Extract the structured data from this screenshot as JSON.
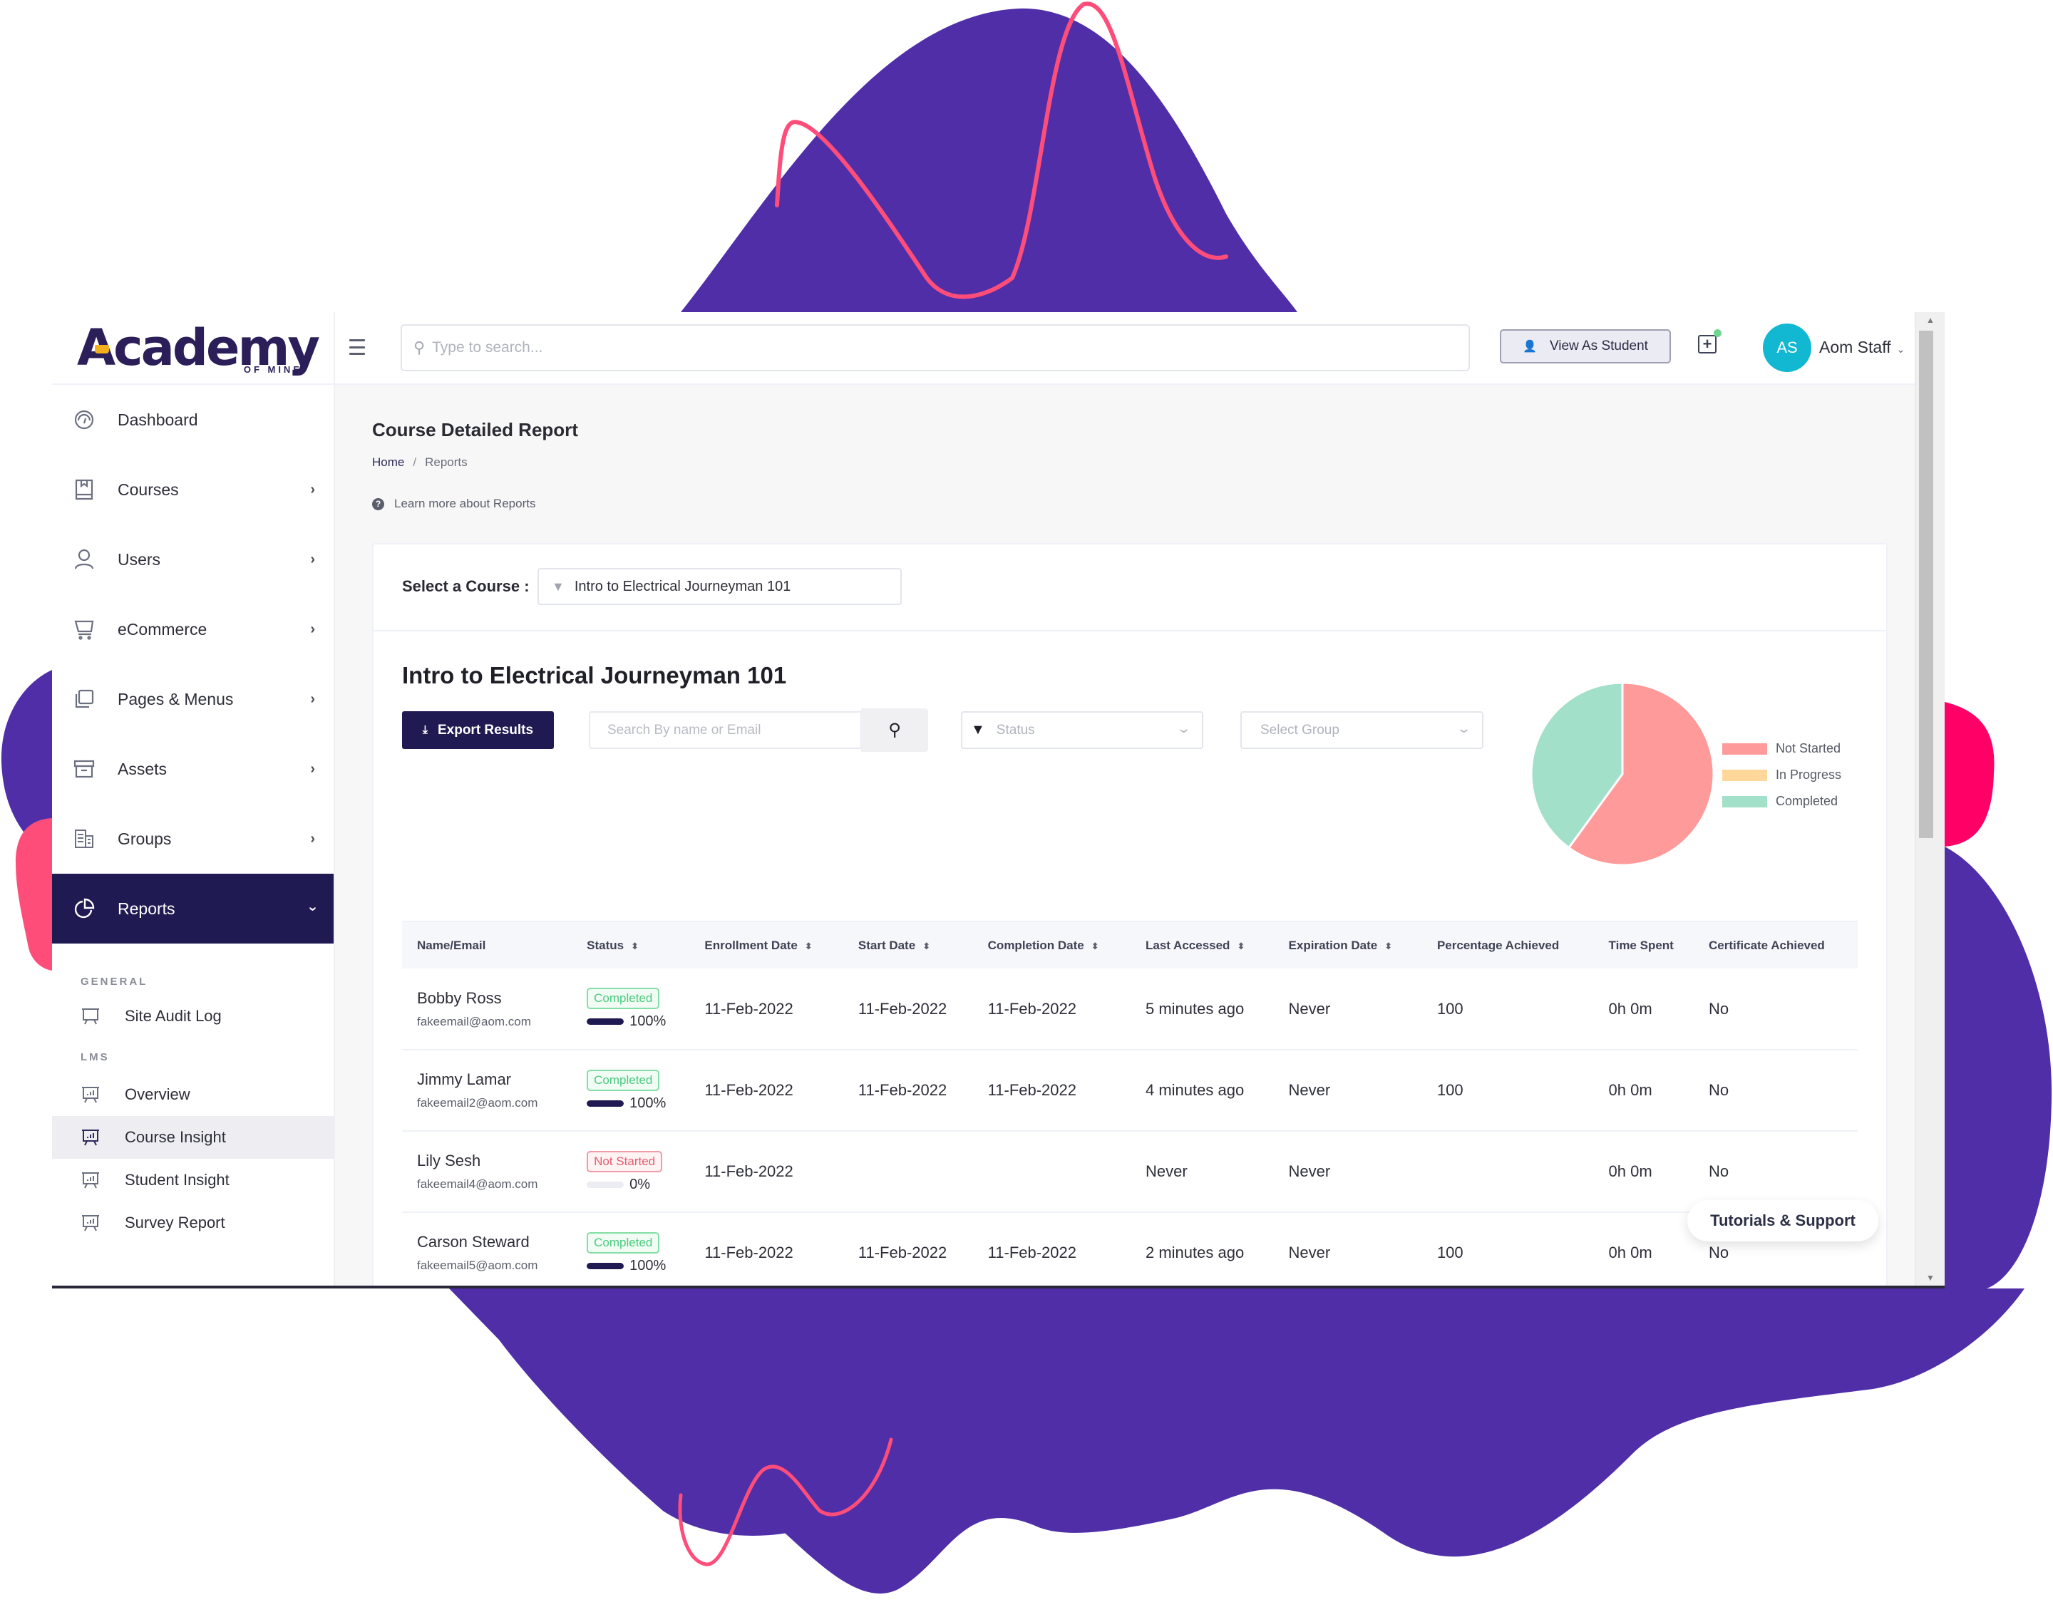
{
  "app": {
    "logo_text": "Academy",
    "logo_subtext": "OF MINE"
  },
  "header": {
    "search_placeholder": "Type to search...",
    "view_as_student": "View As Student",
    "avatar_initials": "AS",
    "user_name": "Aom Staff"
  },
  "sidebar": {
    "items": [
      {
        "label": "Dashboard",
        "icon": "gauge-icon",
        "has_children": false
      },
      {
        "label": "Courses",
        "icon": "book-icon",
        "has_children": true
      },
      {
        "label": "Users",
        "icon": "user-icon",
        "has_children": true
      },
      {
        "label": "eCommerce",
        "icon": "cart-icon",
        "has_children": true
      },
      {
        "label": "Pages & Menus",
        "icon": "pages-icon",
        "has_children": true
      },
      {
        "label": "Assets",
        "icon": "archive-icon",
        "has_children": true
      },
      {
        "label": "Groups",
        "icon": "building-icon",
        "has_children": true
      },
      {
        "label": "Reports",
        "icon": "pie-chart-icon",
        "has_children": true,
        "active": true
      }
    ],
    "reports_submenu": {
      "general_heading": "GENERAL",
      "general_items": [
        {
          "label": "Site Audit Log"
        }
      ],
      "lms_heading": "LMS",
      "lms_items": [
        {
          "label": "Overview"
        },
        {
          "label": "Course Insight",
          "current": true
        },
        {
          "label": "Student Insight"
        },
        {
          "label": "Survey Report"
        }
      ]
    }
  },
  "page": {
    "title": "Course Detailed Report",
    "breadcrumb": {
      "home": "Home",
      "separator": "/",
      "current": "Reports"
    },
    "learn_more": "Learn more about Reports",
    "select_course_label": "Select a Course :",
    "selected_course": "Intro to Electrical Journeyman 101",
    "course_heading": "Intro to Electrical Journeyman 101",
    "export_button": "Export Results",
    "name_search_placeholder": "Search By name or Email",
    "status_placeholder": "Status",
    "group_placeholder": "Select Group",
    "tutorials_button": "Tutorials & Support"
  },
  "chart_data": {
    "type": "pie",
    "title": "",
    "legend_position": "right",
    "categories": [
      "Not Started",
      "In Progress",
      "Completed"
    ],
    "values": [
      60,
      0,
      40
    ],
    "unit": "percent",
    "colors": [
      "#ff9a9a",
      "#ffd79a",
      "#a2e0c9"
    ]
  },
  "table": {
    "columns": [
      {
        "label": "Name/Email",
        "sortable": false
      },
      {
        "label": "Status",
        "sortable": true
      },
      {
        "label": "Enrollment Date",
        "sortable": true
      },
      {
        "label": "Start Date",
        "sortable": true
      },
      {
        "label": "Completion Date",
        "sortable": true
      },
      {
        "label": "Last Accessed",
        "sortable": true
      },
      {
        "label": "Expiration Date",
        "sortable": true
      },
      {
        "label": "Percentage Achieved",
        "sortable": false
      },
      {
        "label": "Time Spent",
        "sortable": false
      },
      {
        "label": "Certificate Achieved",
        "sortable": false
      }
    ],
    "rows": [
      {
        "name": "Bobby Ross",
        "email": "fakeemail@aom.com",
        "status": "Completed",
        "status_key": "completed",
        "progress": 100,
        "progress_label": "100%",
        "enrollment": "11-Feb-2022",
        "start": "11-Feb-2022",
        "completion": "11-Feb-2022",
        "last_accessed": "5 minutes ago",
        "expiration": "Never",
        "percentage": "100",
        "time_spent": "0h 0m",
        "certificate": "No"
      },
      {
        "name": "Jimmy Lamar",
        "email": "fakeemail2@aom.com",
        "status": "Completed",
        "status_key": "completed",
        "progress": 100,
        "progress_label": "100%",
        "enrollment": "11-Feb-2022",
        "start": "11-Feb-2022",
        "completion": "11-Feb-2022",
        "last_accessed": "4 minutes ago",
        "expiration": "Never",
        "percentage": "100",
        "time_spent": "0h 0m",
        "certificate": "No"
      },
      {
        "name": "Lily Sesh",
        "email": "fakeemail4@aom.com",
        "status": "Not Started",
        "status_key": "not-started",
        "progress": 0,
        "progress_label": "0%",
        "enrollment": "11-Feb-2022",
        "start": "",
        "completion": "",
        "last_accessed": "Never",
        "expiration": "Never",
        "percentage": "",
        "time_spent": "0h 0m",
        "certificate": "No"
      },
      {
        "name": "Carson Steward",
        "email": "fakeemail5@aom.com",
        "status": "Completed",
        "status_key": "completed",
        "progress": 100,
        "progress_label": "100%",
        "enrollment": "11-Feb-2022",
        "start": "11-Feb-2022",
        "completion": "11-Feb-2022",
        "last_accessed": "2 minutes ago",
        "expiration": "Never",
        "percentage": "100",
        "time_spent": "0h 0m",
        "certificate": "No"
      }
    ]
  },
  "colors": {
    "brand_dark": "#1f1a52",
    "decor_purple": "#4f2ea8",
    "decor_pink": "#ff4d7a",
    "decor_magenta": "#ff0066",
    "avatar_bg": "#12b7d2"
  }
}
